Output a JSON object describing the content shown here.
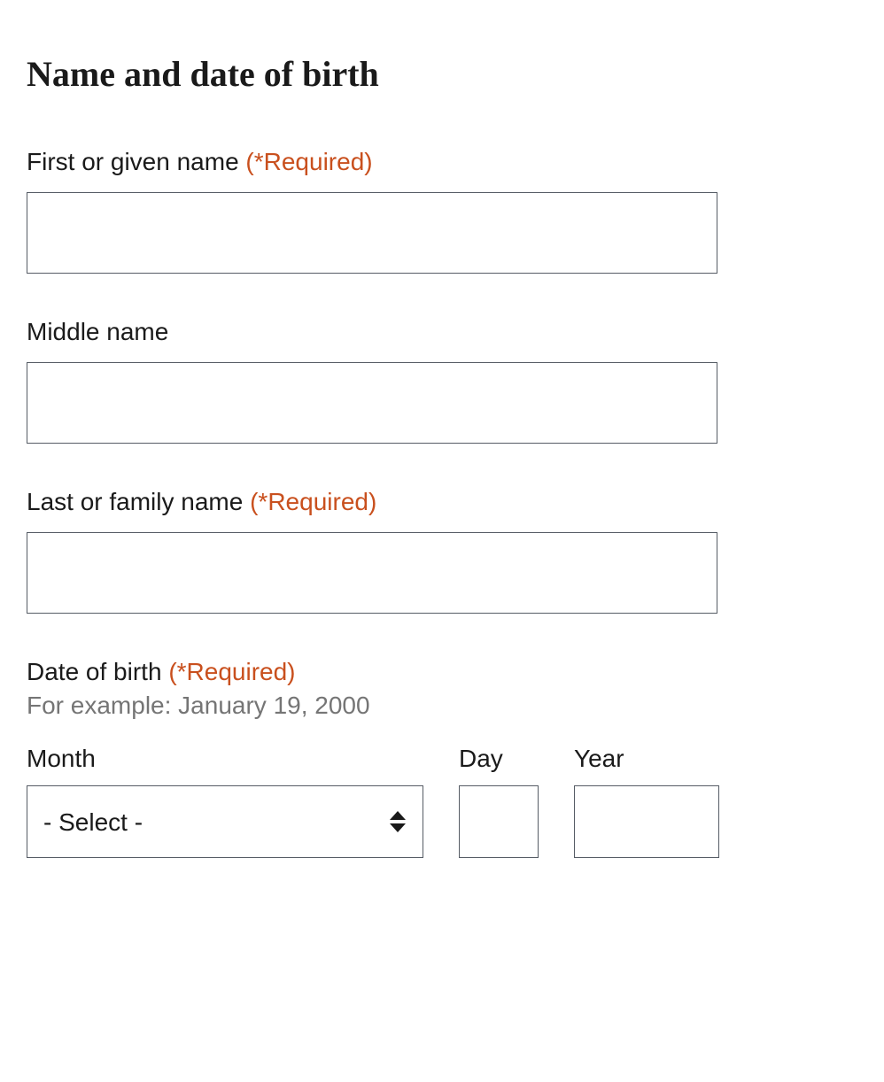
{
  "title": "Name and date of birth",
  "required_marker": "(*Required)",
  "fields": {
    "first_name": {
      "label": "First or given name ",
      "value": ""
    },
    "middle_name": {
      "label": "Middle name",
      "value": ""
    },
    "last_name": {
      "label": "Last or family name ",
      "value": ""
    },
    "dob": {
      "label": "Date of birth ",
      "hint": "For example: January 19, 2000",
      "month": {
        "label": "Month",
        "selected": "- Select -"
      },
      "day": {
        "label": "Day",
        "value": ""
      },
      "year": {
        "label": "Year",
        "value": ""
      }
    }
  }
}
